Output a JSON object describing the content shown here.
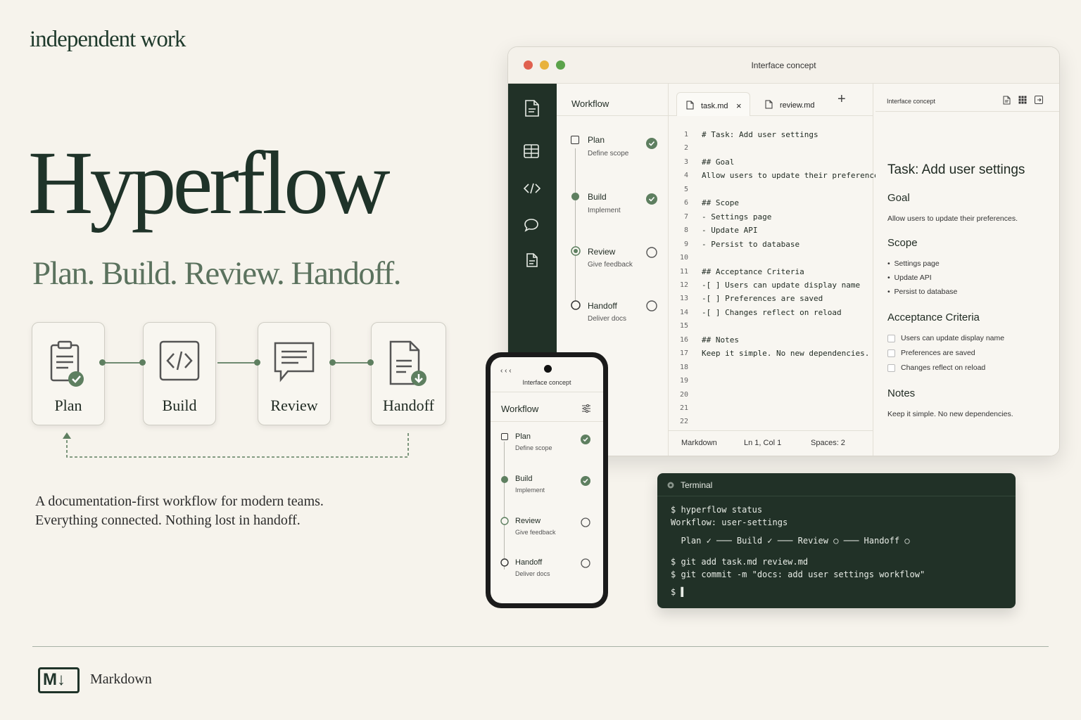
{
  "brand": "independent work",
  "hero": {
    "title": "Hyperflow",
    "tagline": "Plan. Build. Review. Handoff."
  },
  "steps": [
    {
      "label": "Plan",
      "icon": "clipboard-check-icon"
    },
    {
      "label": "Build",
      "icon": "code-icon"
    },
    {
      "label": "Review",
      "icon": "chat-icon"
    },
    {
      "label": "Handoff",
      "icon": "document-download-icon"
    }
  ],
  "description": {
    "line1": "A documentation-first workflow for modern teams.",
    "line2": "Everything connected. Nothing lost in handoff."
  },
  "footer": {
    "markdown_label": "Markdown",
    "logo_text": "M↓"
  },
  "desktop": {
    "window_title": "Interface concept",
    "sidebar_title": "Workflow",
    "workflow": [
      {
        "title": "Plan",
        "subtitle": "Define scope",
        "status": "done"
      },
      {
        "title": "Build",
        "subtitle": "Implement",
        "status": "done"
      },
      {
        "title": "Review",
        "subtitle": "Give feedback",
        "status": "pending"
      },
      {
        "title": "Handoff",
        "subtitle": "Deliver docs",
        "status": "pending"
      }
    ],
    "tabs": [
      {
        "label": "task.md",
        "close": "×"
      },
      {
        "label": "review.md"
      }
    ],
    "add_tab": "+",
    "code_lines": [
      "# Task: Add user settings",
      "",
      "## Goal",
      "Allow users to update their preferences.",
      "",
      "## Scope",
      "- Settings page",
      "- Update API",
      "- Persist to database",
      "",
      "## Acceptance Criteria",
      "-[ ] Users can update display name",
      "-[ ] Preferences are saved",
      "-[ ] Changes reflect on reload",
      "",
      "## Notes",
      "Keep it simple. No new dependencies.",
      "",
      "",
      "",
      "",
      ""
    ],
    "line_numbers": [
      "1",
      "2",
      "3",
      "4",
      "5",
      "6",
      "7",
      "8",
      "9",
      "10",
      "11",
      "12",
      "13",
      "14",
      "15",
      "16",
      "17",
      "18",
      "19",
      "20",
      "21",
      "22"
    ],
    "status_bar": {
      "language": "Markdown",
      "position": "Ln 1, Col 1",
      "spaces": "Spaces: 2"
    },
    "preview": {
      "header": "Interface concept",
      "title": "Task: Add user settings",
      "goal_heading": "Goal",
      "goal_text": "Allow users to update their preferences.",
      "scope_heading": "Scope",
      "scope_items": [
        "Settings page",
        "Update API",
        "Persist to database"
      ],
      "criteria_heading": "Acceptance Criteria",
      "criteria_items": [
        "Users can update display name",
        "Preferences are saved",
        "Changes reflect on reload"
      ],
      "notes_heading": "Notes",
      "notes_text": "Keep it simple. No new dependencies."
    }
  },
  "phone": {
    "nav": "‹ ‹ ‹",
    "title": "Interface concept",
    "section": "Workflow",
    "items": [
      {
        "title": "Plan",
        "subtitle": "Define scope",
        "status": "done"
      },
      {
        "title": "Build",
        "subtitle": "Implement",
        "status": "done"
      },
      {
        "title": "Review",
        "subtitle": "Give feedback",
        "status": "pending"
      },
      {
        "title": "Handoff",
        "subtitle": "Deliver docs",
        "status": "pending"
      }
    ]
  },
  "terminal": {
    "title": "Terminal",
    "lines": [
      "$ hyperflow status",
      "Workflow: user-settings",
      "  Plan ✓ ─── Build ✓ ─── Review ○ ─── Handoff ○",
      "$ git add task.md review.md",
      "$ git commit -m \"docs: add user settings workflow\"",
      "$ ▌"
    ]
  },
  "colors": {
    "accent_green": "#5e7f60",
    "dark_green": "#213127",
    "background": "#f6f3ec"
  }
}
